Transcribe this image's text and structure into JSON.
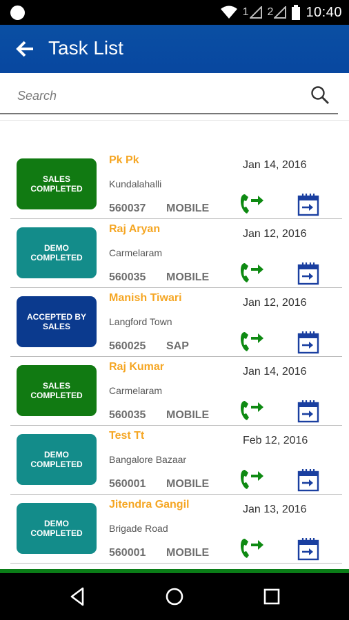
{
  "status_bar": {
    "sim1": "1",
    "sim2": "2",
    "time": "10:40"
  },
  "app_bar": {
    "title": "Task List"
  },
  "search": {
    "placeholder": "Search"
  },
  "tasks": [
    {
      "status": "SALES COMPLETED",
      "status_type": "sales",
      "name": "Pk Pk",
      "area": "Kundalahalli",
      "pincode": "560037",
      "source": "MOBILE",
      "date": "Jan 14, 2016"
    },
    {
      "status": "DEMO COMPLETED",
      "status_type": "demo",
      "name": "Raj Aryan",
      "area": "Carmelaram",
      "pincode": "560035",
      "source": "MOBILE",
      "date": "Jan 12, 2016"
    },
    {
      "status": "ACCEPTED BY SALES",
      "status_type": "accepted",
      "name": "Manish Tiwari",
      "area": "Langford Town",
      "pincode": "560025",
      "source": "SAP",
      "date": "Jan 12, 2016"
    },
    {
      "status": "SALES COMPLETED",
      "status_type": "sales",
      "name": "Raj Kumar",
      "area": "Carmelaram",
      "pincode": "560035",
      "source": "MOBILE",
      "date": "Jan 14, 2016"
    },
    {
      "status": "DEMO COMPLETED",
      "status_type": "demo",
      "name": "Test Tt",
      "area": "Bangalore Bazaar",
      "pincode": "560001",
      "source": "MOBILE",
      "date": "Feb 12, 2016"
    },
    {
      "status": "DEMO COMPLETED",
      "status_type": "demo",
      "name": "Jitendra Gangil",
      "area": "Brigade Road",
      "pincode": "560001",
      "source": "MOBILE",
      "date": "Jan 13, 2016"
    }
  ],
  "colors": {
    "app_bar": "#0a4fa3",
    "name": "#f5a623",
    "call_icon": "#0e8a12",
    "calendar_icon": "#1a3fa0",
    "sales": "#117a12",
    "demo": "#138c8a",
    "accepted": "#0b3a8e"
  },
  "icons": {
    "back": "arrow-left-icon",
    "search": "search-icon",
    "call": "call-forward-icon",
    "calendar": "calendar-arrow-icon"
  }
}
